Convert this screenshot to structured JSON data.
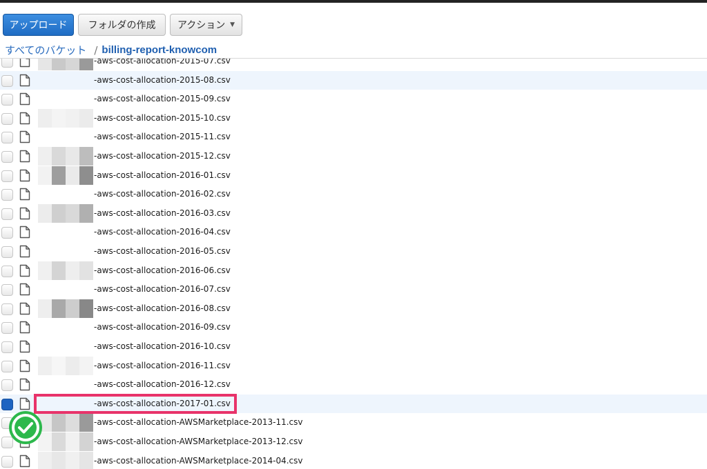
{
  "toolbar": {
    "upload_label": "アップロード",
    "create_folder_label": "フォルダの作成",
    "actions_label": "アクション"
  },
  "breadcrumb": {
    "root_label": "すべてのバケット",
    "separator": "/",
    "bucket_name": "billing-report-knowcom"
  },
  "files": [
    {
      "name": "-aws-cost-allocation-2015-07.csv",
      "selected": false,
      "highlighted": false
    },
    {
      "name": "-aws-cost-allocation-2015-08.csv",
      "selected": false,
      "highlighted": true
    },
    {
      "name": "-aws-cost-allocation-2015-09.csv",
      "selected": false,
      "highlighted": false
    },
    {
      "name": "-aws-cost-allocation-2015-10.csv",
      "selected": false,
      "highlighted": false
    },
    {
      "name": "-aws-cost-allocation-2015-11.csv",
      "selected": false,
      "highlighted": false
    },
    {
      "name": "-aws-cost-allocation-2015-12.csv",
      "selected": false,
      "highlighted": false
    },
    {
      "name": "-aws-cost-allocation-2016-01.csv",
      "selected": false,
      "highlighted": false
    },
    {
      "name": "-aws-cost-allocation-2016-02.csv",
      "selected": false,
      "highlighted": false
    },
    {
      "name": "-aws-cost-allocation-2016-03.csv",
      "selected": false,
      "highlighted": false
    },
    {
      "name": "-aws-cost-allocation-2016-04.csv",
      "selected": false,
      "highlighted": false
    },
    {
      "name": "-aws-cost-allocation-2016-05.csv",
      "selected": false,
      "highlighted": false
    },
    {
      "name": "-aws-cost-allocation-2016-06.csv",
      "selected": false,
      "highlighted": false
    },
    {
      "name": "-aws-cost-allocation-2016-07.csv",
      "selected": false,
      "highlighted": false
    },
    {
      "name": "-aws-cost-allocation-2016-08.csv",
      "selected": false,
      "highlighted": false
    },
    {
      "name": "-aws-cost-allocation-2016-09.csv",
      "selected": false,
      "highlighted": false
    },
    {
      "name": "-aws-cost-allocation-2016-10.csv",
      "selected": false,
      "highlighted": false
    },
    {
      "name": "-aws-cost-allocation-2016-11.csv",
      "selected": false,
      "highlighted": false
    },
    {
      "name": "-aws-cost-allocation-2016-12.csv",
      "selected": false,
      "highlighted": false
    },
    {
      "name": "-aws-cost-allocation-2017-01.csv",
      "selected": true,
      "highlighted": true
    },
    {
      "name": "-aws-cost-allocation-AWSMarketplace-2013-11.csv",
      "selected": false,
      "highlighted": false
    },
    {
      "name": "-aws-cost-allocation-AWSMarketplace-2013-12.csv",
      "selected": false,
      "highlighted": false
    },
    {
      "name": "-aws-cost-allocation-AWSMarketplace-2014-04.csv",
      "selected": false,
      "highlighted": false
    }
  ],
  "colors": {
    "primary_button": "#1f6cc4",
    "link": "#2a6cbe",
    "row_highlight": "#eef5fd",
    "annotation": "#e8336a",
    "success_badge": "#2db84c"
  }
}
